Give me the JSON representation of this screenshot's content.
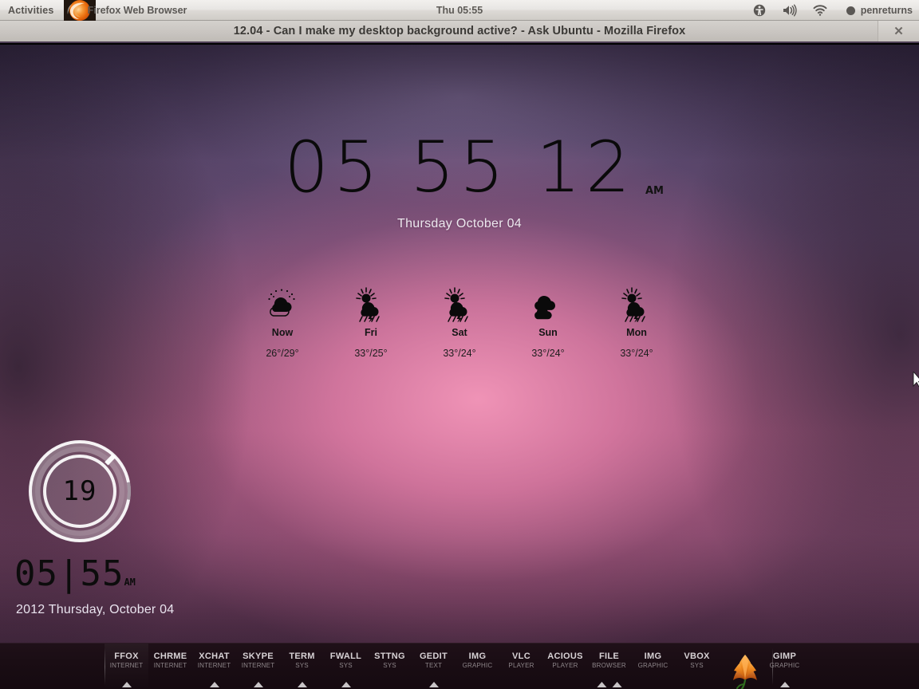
{
  "topbar": {
    "activities": "Activities",
    "app_name": "Firefox Web Browser",
    "app_icon": "firefox-icon",
    "clock": "Thu 05:55",
    "tray": {
      "accessibility_icon": "accessibility-icon",
      "volume_icon": "volume-icon",
      "network_icon": "wifi-icon",
      "user_icon": "chat-bubble-icon",
      "user_name": "penreturns"
    }
  },
  "window": {
    "title": "12.04 - Can I make my desktop background active? - Ask Ubuntu - Mozilla Firefox",
    "close_label": "✕"
  },
  "desktop": {
    "big_clock": {
      "time": "05 55 12",
      "meridiem": "AM",
      "date": "Thursday October 04"
    },
    "weather": {
      "days": [
        {
          "day": "Now",
          "temp": "26°/29°",
          "icon": "partly-cloudy-night-icon"
        },
        {
          "day": "Fri",
          "temp": "33°/25°",
          "icon": "sun-thunderstorm-icon"
        },
        {
          "day": "Sat",
          "temp": "33°/24°",
          "icon": "sun-thunderstorm-icon"
        },
        {
          "day": "Sun",
          "temp": "33°/24°",
          "icon": "cloudy-icon"
        },
        {
          "day": "Mon",
          "temp": "33°/24°",
          "icon": "sun-thunderstorm-icon"
        }
      ]
    },
    "conky": {
      "ring_value": "19",
      "time": "05|55",
      "meridiem": "AM",
      "date": "2012 Thursday, October 04"
    }
  },
  "dock": {
    "items": [
      {
        "label": "FFOX",
        "sub": "INTERNET",
        "running": true,
        "active": true,
        "double": false
      },
      {
        "label": "CHRME",
        "sub": "INTERNET",
        "running": false,
        "active": false,
        "double": false
      },
      {
        "label": "XCHAT",
        "sub": "INTERNET",
        "running": true,
        "active": false,
        "double": false
      },
      {
        "label": "SKYPE",
        "sub": "INTERNET",
        "running": true,
        "active": false,
        "double": false
      },
      {
        "label": "TERM",
        "sub": "SYS",
        "running": true,
        "active": false,
        "double": false
      },
      {
        "label": "FWALL",
        "sub": "SYS",
        "running": true,
        "active": false,
        "double": false
      },
      {
        "label": "STTNG",
        "sub": "SYS",
        "running": false,
        "active": false,
        "double": false
      },
      {
        "label": "GEDIT",
        "sub": "TEXT",
        "running": true,
        "active": false,
        "double": false
      },
      {
        "label": "IMG",
        "sub": "GRAPHIC",
        "running": false,
        "active": false,
        "double": false
      },
      {
        "label": "VLC",
        "sub": "PLAYER",
        "running": false,
        "active": false,
        "double": false
      },
      {
        "label": "ACIOUS",
        "sub": "PLAYER",
        "running": false,
        "active": false,
        "double": false
      },
      {
        "label": "FILE",
        "sub": "BROWSER",
        "running": true,
        "active": false,
        "double": true
      },
      {
        "label": "IMG",
        "sub": "GRAPHIC",
        "running": false,
        "active": false,
        "double": false
      },
      {
        "label": "VBOX",
        "sub": "SYS",
        "running": false,
        "active": false,
        "double": false
      },
      {
        "label": "GIMP",
        "sub": "GRAPHIC",
        "running": true,
        "active": false,
        "double": false
      }
    ],
    "gimp_flower_icon": "lotus-flower-icon"
  },
  "colors": {
    "panel_bg": "#e8e6e3",
    "panel_text": "#5a5754",
    "titlebar_bg": "#cac6c2",
    "wallpaper_pink": "#b06289",
    "wallpaper_purple": "#4a3a58",
    "dock_bg": "#1a0d14",
    "dock_label": "#d7d2d5",
    "dock_sub": "#8d8589",
    "firefox_orange": "#e8690b",
    "gimp_lotus_orange": "#e87820"
  }
}
